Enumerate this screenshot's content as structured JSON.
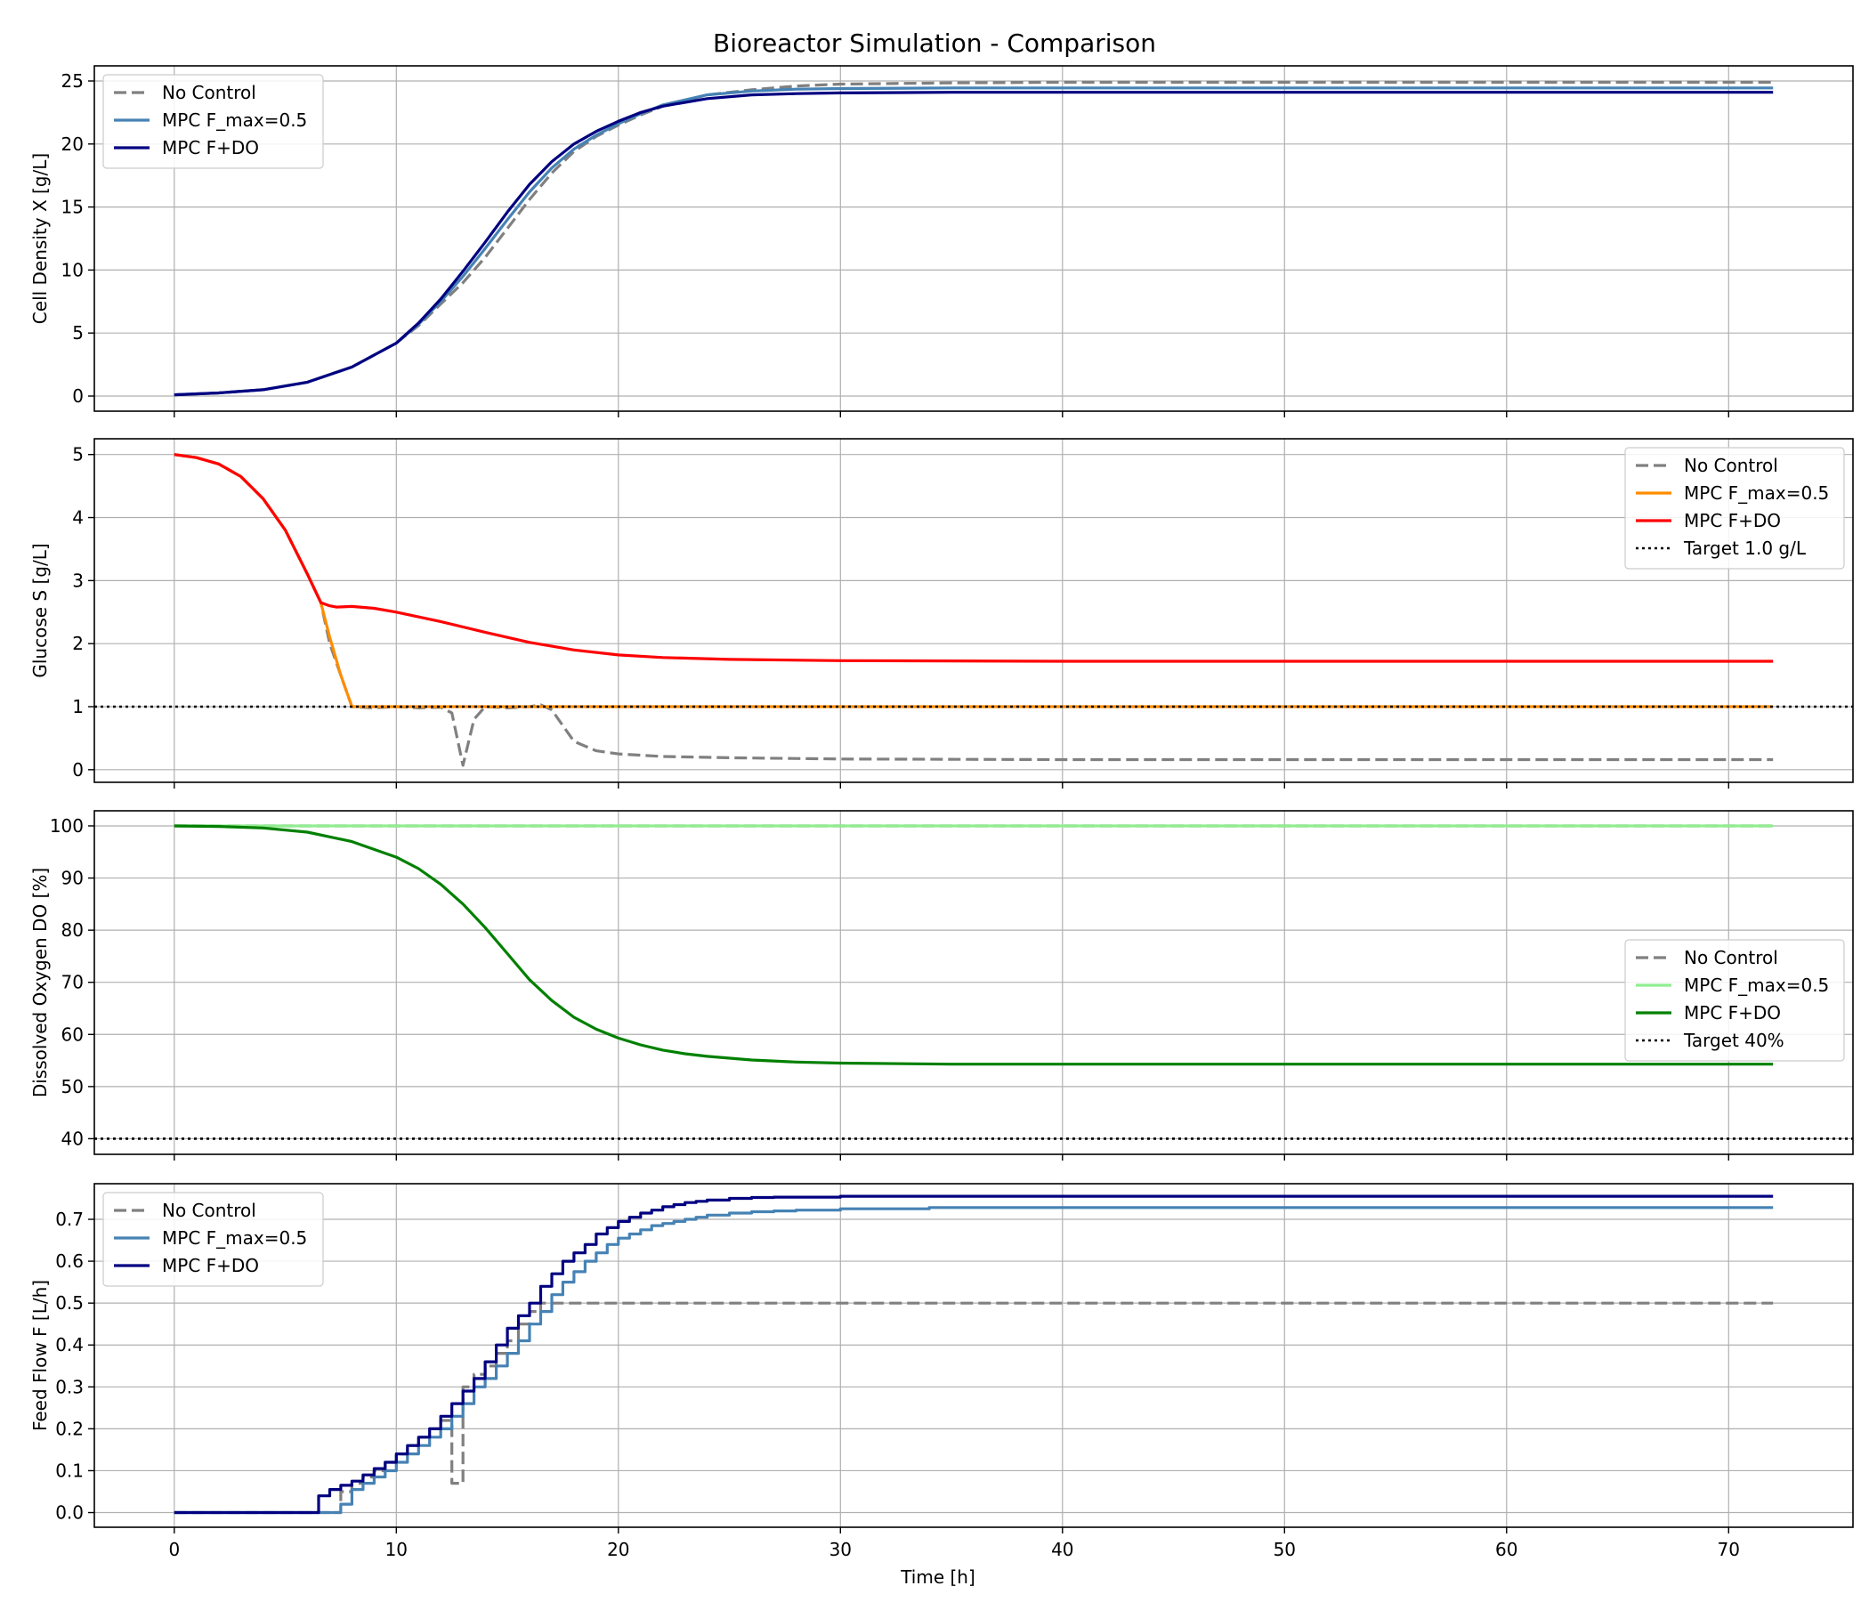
{
  "figure": {
    "title": "Bioreactor Simulation - Comparison",
    "xlabel": "Time [h]"
  },
  "chart_data": [
    {
      "type": "line",
      "ylabel": "Cell Density X [g/L]",
      "xlim": [
        -3.6,
        75.6
      ],
      "ylim": [
        -1.2,
        26.2
      ],
      "xticks": [
        0,
        10,
        20,
        30,
        40,
        50,
        60,
        70
      ],
      "yticks": [
        0,
        5,
        10,
        15,
        20,
        25
      ],
      "grid": true,
      "legend": "upper left",
      "series": [
        {
          "name": "No Control",
          "color": "#808080",
          "style": "dashed",
          "x": [
            0,
            2,
            4,
            6,
            8,
            10,
            11,
            12,
            13,
            14,
            15,
            16,
            17,
            18,
            19,
            20,
            21,
            22,
            24,
            26,
            28,
            30,
            35,
            40,
            50,
            60,
            72
          ],
          "y": [
            0.1,
            0.25,
            0.5,
            1.1,
            2.3,
            4.2,
            5.6,
            7.3,
            9.0,
            11.0,
            13.3,
            15.6,
            17.7,
            19.4,
            20.6,
            21.5,
            22.3,
            23.0,
            23.9,
            24.3,
            24.6,
            24.75,
            24.85,
            24.9,
            24.9,
            24.9,
            24.9
          ]
        },
        {
          "name": "MPC F_max=0.5",
          "color": "#4682B4",
          "style": "solid",
          "x": [
            0,
            2,
            4,
            6,
            8,
            10,
            11,
            12,
            13,
            14,
            15,
            16,
            17,
            18,
            19,
            20,
            21,
            22,
            24,
            26,
            28,
            30,
            35,
            40,
            50,
            60,
            72
          ],
          "y": [
            0.1,
            0.25,
            0.5,
            1.1,
            2.3,
            4.2,
            5.7,
            7.5,
            9.5,
            11.7,
            14.0,
            16.2,
            18.1,
            19.6,
            20.7,
            21.6,
            22.4,
            23.1,
            23.9,
            24.2,
            24.35,
            24.4,
            24.45,
            24.45,
            24.45,
            24.45,
            24.45
          ]
        },
        {
          "name": "MPC F+DO",
          "color": "#000080",
          "style": "solid",
          "x": [
            0,
            2,
            4,
            6,
            8,
            10,
            11,
            12,
            13,
            14,
            15,
            16,
            17,
            18,
            19,
            20,
            21,
            22,
            24,
            26,
            28,
            30,
            35,
            40,
            50,
            60,
            72
          ],
          "y": [
            0.1,
            0.25,
            0.5,
            1.1,
            2.3,
            4.2,
            5.8,
            7.7,
            9.9,
            12.2,
            14.6,
            16.8,
            18.6,
            20.0,
            21.0,
            21.8,
            22.5,
            23.0,
            23.6,
            23.9,
            24.0,
            24.05,
            24.1,
            24.1,
            24.1,
            24.1,
            24.1
          ]
        }
      ]
    },
    {
      "type": "line",
      "ylabel": "Glucose S [g/L]",
      "xlim": [
        -3.6,
        75.6
      ],
      "ylim": [
        -0.2,
        5.25
      ],
      "xticks": [
        0,
        10,
        20,
        30,
        40,
        50,
        60,
        70
      ],
      "yticks": [
        0,
        1,
        2,
        3,
        4,
        5
      ],
      "grid": true,
      "legend": "upper right",
      "series": [
        {
          "name": "No Control",
          "color": "#808080",
          "style": "dashed",
          "x": [
            0,
            1,
            2,
            3,
            4,
            5,
            6,
            6.6,
            7,
            7.5,
            8,
            9,
            10,
            11,
            12,
            12.5,
            13,
            13.5,
            14,
            15,
            16,
            16.5,
            17,
            17.5,
            18,
            19,
            20,
            22,
            25,
            30,
            40,
            50,
            60,
            72
          ],
          "y": [
            5.0,
            4.95,
            4.85,
            4.65,
            4.3,
            3.8,
            3.1,
            2.65,
            2.0,
            1.5,
            1.0,
            0.98,
            1.0,
            0.98,
            0.99,
            0.9,
            0.07,
            0.8,
            1.0,
            0.98,
            1.0,
            1.03,
            0.95,
            0.7,
            0.45,
            0.3,
            0.25,
            0.21,
            0.19,
            0.17,
            0.16,
            0.16,
            0.16,
            0.16
          ]
        },
        {
          "name": "MPC F_max=0.5",
          "color": "#FF8C00",
          "style": "solid",
          "x": [
            0,
            1,
            2,
            3,
            4,
            5,
            6,
            6.6,
            7,
            7.5,
            8,
            10,
            20,
            30,
            40,
            50,
            60,
            72
          ],
          "y": [
            5.0,
            4.95,
            4.85,
            4.65,
            4.3,
            3.8,
            3.1,
            2.65,
            2.1,
            1.5,
            1.0,
            1.0,
            1.0,
            1.0,
            1.0,
            1.0,
            1.0,
            1.0
          ]
        },
        {
          "name": "MPC F+DO",
          "color": "#FF0000",
          "style": "solid",
          "x": [
            0,
            1,
            2,
            3,
            4,
            5,
            6,
            6.6,
            7,
            7.3,
            8,
            9,
            10,
            12,
            14,
            16,
            18,
            20,
            22,
            25,
            30,
            40,
            50,
            60,
            72
          ],
          "y": [
            5.0,
            4.95,
            4.85,
            4.65,
            4.3,
            3.8,
            3.1,
            2.65,
            2.6,
            2.58,
            2.59,
            2.56,
            2.5,
            2.35,
            2.18,
            2.02,
            1.9,
            1.82,
            1.78,
            1.75,
            1.73,
            1.72,
            1.72,
            1.72,
            1.72
          ]
        },
        {
          "name": "Target 1.0 g/L",
          "color": "#000000",
          "style": "dotted",
          "x": [
            -3.6,
            75.6
          ],
          "y": [
            1.0,
            1.0
          ]
        }
      ]
    },
    {
      "type": "line",
      "ylabel": "Dissolved Oxygen DO [%]",
      "xlim": [
        -3.6,
        75.6
      ],
      "ylim": [
        37.0,
        102.9
      ],
      "xticks": [
        0,
        10,
        20,
        30,
        40,
        50,
        60,
        70
      ],
      "yticks": [
        40,
        50,
        60,
        70,
        80,
        90,
        100
      ],
      "grid": true,
      "legend": "center right",
      "series": [
        {
          "name": "No Control",
          "color": "#808080",
          "style": "dashed",
          "x": [
            0,
            72
          ],
          "y": [
            100,
            100
          ]
        },
        {
          "name": "MPC F_max=0.5",
          "color": "#90EE90",
          "style": "solid",
          "x": [
            0,
            72
          ],
          "y": [
            100,
            100
          ]
        },
        {
          "name": "MPC F+DO",
          "color": "#008000",
          "style": "solid",
          "x": [
            0,
            2,
            4,
            6,
            8,
            10,
            11,
            12,
            13,
            14,
            15,
            16,
            17,
            18,
            19,
            20,
            21,
            22,
            23,
            24,
            26,
            28,
            30,
            35,
            40,
            50,
            60,
            72
          ],
          "y": [
            100,
            99.9,
            99.6,
            98.8,
            97.0,
            94.0,
            91.8,
            88.8,
            85.0,
            80.5,
            75.5,
            70.5,
            66.5,
            63.3,
            61.0,
            59.3,
            58.0,
            57.0,
            56.3,
            55.8,
            55.1,
            54.7,
            54.5,
            54.3,
            54.3,
            54.3,
            54.3,
            54.3
          ]
        },
        {
          "name": "Target 40%",
          "color": "#000000",
          "style": "dotted",
          "x": [
            -3.6,
            75.6
          ],
          "y": [
            40,
            40
          ]
        }
      ]
    },
    {
      "type": "line",
      "ylabel": "Feed Flow F [L/h]",
      "xlim": [
        -3.6,
        75.6
      ],
      "ylim": [
        -0.035,
        0.785
      ],
      "xticks": [
        0,
        10,
        20,
        30,
        40,
        50,
        60,
        70
      ],
      "yticks": [
        0.0,
        0.1,
        0.2,
        0.3,
        0.4,
        0.5,
        0.6,
        0.7
      ],
      "ytick_labels": [
        "0.0",
        "0.1",
        "0.2",
        "0.3",
        "0.4",
        "0.5",
        "0.6",
        "0.7"
      ],
      "grid": true,
      "legend": "upper left",
      "series": [
        {
          "name": "No Control",
          "color": "#808080",
          "style": "dashed",
          "step": true,
          "x": [
            0,
            7.5,
            8,
            8.5,
            9,
            9.5,
            10,
            10.5,
            11,
            11.5,
            12,
            12.5,
            13,
            13.5,
            14,
            14.5,
            15,
            15.5,
            16,
            16.5,
            72
          ],
          "y": [
            0,
            0.05,
            0.07,
            0.085,
            0.1,
            0.12,
            0.14,
            0.16,
            0.18,
            0.2,
            0.22,
            0.07,
            0.3,
            0.33,
            0.35,
            0.38,
            0.41,
            0.45,
            0.48,
            0.5,
            0.5
          ]
        },
        {
          "name": "MPC F_max=0.5",
          "color": "#4682B4",
          "style": "solid",
          "step": true,
          "x": [
            0,
            7.5,
            8,
            8.5,
            9,
            9.5,
            10,
            10.5,
            11,
            11.5,
            12,
            12.5,
            13,
            13.5,
            14,
            14.5,
            15,
            15.5,
            16,
            16.5,
            17,
            17.5,
            18,
            18.5,
            19,
            19.5,
            20,
            20.5,
            21,
            21.5,
            22,
            22.5,
            23,
            23.5,
            24,
            25,
            26,
            27,
            28,
            30,
            34,
            72
          ],
          "y": [
            0,
            0.02,
            0.055,
            0.07,
            0.085,
            0.1,
            0.12,
            0.14,
            0.16,
            0.18,
            0.2,
            0.23,
            0.26,
            0.3,
            0.32,
            0.35,
            0.38,
            0.41,
            0.45,
            0.48,
            0.52,
            0.55,
            0.575,
            0.6,
            0.62,
            0.64,
            0.655,
            0.665,
            0.675,
            0.685,
            0.69,
            0.695,
            0.7,
            0.705,
            0.71,
            0.715,
            0.718,
            0.72,
            0.722,
            0.725,
            0.728,
            0.728
          ]
        },
        {
          "name": "MPC F+DO",
          "color": "#000080",
          "style": "solid",
          "step": true,
          "x": [
            0,
            6.5,
            7,
            7.5,
            8,
            8.5,
            9,
            9.5,
            10,
            10.5,
            11,
            11.5,
            12,
            12.5,
            13,
            13.5,
            14,
            14.5,
            15,
            15.5,
            16,
            16.5,
            17,
            17.5,
            18,
            18.5,
            19,
            19.5,
            20,
            20.5,
            21,
            21.5,
            22,
            22.5,
            23,
            23.5,
            24,
            25,
            26,
            27,
            30,
            72
          ],
          "y": [
            0,
            0.04,
            0.055,
            0.065,
            0.075,
            0.09,
            0.105,
            0.12,
            0.14,
            0.16,
            0.18,
            0.2,
            0.23,
            0.26,
            0.29,
            0.32,
            0.36,
            0.4,
            0.44,
            0.47,
            0.5,
            0.54,
            0.57,
            0.6,
            0.62,
            0.64,
            0.665,
            0.68,
            0.695,
            0.705,
            0.715,
            0.722,
            0.73,
            0.735,
            0.74,
            0.743,
            0.746,
            0.75,
            0.752,
            0.753,
            0.755,
            0.755
          ]
        }
      ]
    }
  ]
}
